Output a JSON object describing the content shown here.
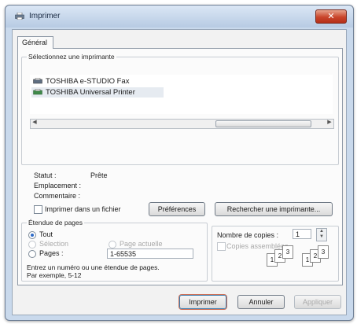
{
  "window": {
    "title": "Imprimer",
    "close_glyph": "✕"
  },
  "tabs": [
    {
      "label": "Général"
    }
  ],
  "printer_group": {
    "legend": "Sélectionnez une imprimante",
    "printers": [
      {
        "name": "TOSHIBA e-STUDIO Fax",
        "icon": "fax-printer-icon"
      },
      {
        "name": "TOSHIBA Universal Printer",
        "icon": "printer-icon",
        "selected": true
      }
    ]
  },
  "status": {
    "status_label": "Statut :",
    "status_value": "Prête",
    "location_label": "Emplacement :",
    "location_value": "",
    "comment_label": "Commentaire :",
    "comment_value": ""
  },
  "print_to_file": {
    "label": "Imprimer dans un fichier",
    "checked": false
  },
  "buttons": {
    "preferences": "Préférences",
    "find_printer": "Rechercher une imprimante...",
    "print": "Imprimer",
    "cancel": "Annuler",
    "apply": "Appliquer"
  },
  "page_range": {
    "legend": "Étendue de pages",
    "all": "Tout",
    "selection": "Sélection",
    "current_page": "Page actuelle",
    "pages": "Pages :",
    "pages_value": "1-65535",
    "hint_line1": "Entrez un numéro ou une étendue de pages.",
    "hint_line2": "Par exemple, 5-12",
    "selected": "all"
  },
  "copies": {
    "label": "Nombre de copies :",
    "value": "1",
    "collate_label": "Copies assemblées",
    "collate_checked": false,
    "sheet_labels": [
      "1",
      "2",
      "3",
      "1",
      "2",
      "3"
    ]
  },
  "colors": {
    "accent": "#2f6bc7",
    "close": "#c9452b"
  }
}
